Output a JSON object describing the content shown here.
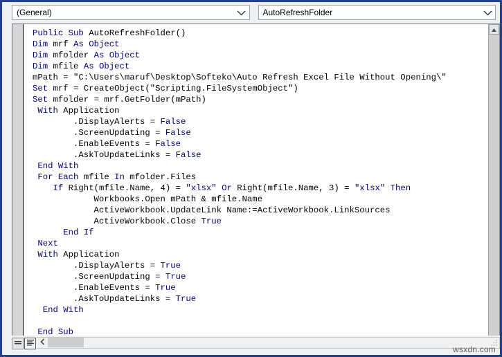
{
  "window": {
    "border_color": "#223f8f",
    "background": "#eef0f2"
  },
  "toolbar": {
    "object_combo": {
      "value": "(General)",
      "placeholder": "(General)",
      "arrow_icon": "chevron-down-icon"
    },
    "procedure_combo": {
      "value": "AutoRefreshFolder",
      "placeholder": "AutoRefreshFolder",
      "arrow_icon": "chevron-down-icon"
    }
  },
  "editor": {
    "keyword_color": "#00007f",
    "text_color": "#000000",
    "background": "#ffffff",
    "lines": [
      [
        {
          "t": "Public Sub ",
          "k": true
        },
        {
          "t": "AutoRefreshFolder()",
          "k": false
        }
      ],
      [
        {
          "t": "Dim ",
          "k": true
        },
        {
          "t": "mrf ",
          "k": false
        },
        {
          "t": "As ",
          "k": true
        },
        {
          "t": "Object",
          "k": true
        }
      ],
      [
        {
          "t": "Dim ",
          "k": true
        },
        {
          "t": "mfolder ",
          "k": false
        },
        {
          "t": "As ",
          "k": true
        },
        {
          "t": "Object",
          "k": true
        }
      ],
      [
        {
          "t": "Dim ",
          "k": true
        },
        {
          "t": "mfile ",
          "k": false
        },
        {
          "t": "As ",
          "k": true
        },
        {
          "t": "Object",
          "k": true
        }
      ],
      [
        {
          "t": "mPath = \"C:\\Users\\maruf\\Desktop\\Softeko\\Auto Refresh Excel File Without Opening\\\"",
          "k": false
        }
      ],
      [
        {
          "t": "Set ",
          "k": true
        },
        {
          "t": "mrf = CreateObject(\"Scripting.FileSystemObject\")",
          "k": false
        }
      ],
      [
        {
          "t": "Set ",
          "k": true
        },
        {
          "t": "mfolder = mrf.GetFolder(mPath)",
          "k": false
        }
      ],
      [
        {
          "t": " ",
          "k": false
        },
        {
          "t": "With ",
          "k": true
        },
        {
          "t": "Application",
          "k": false
        }
      ],
      [
        {
          "t": "        .DisplayAlerts = ",
          "k": false
        },
        {
          "t": "False",
          "k": true
        }
      ],
      [
        {
          "t": "        .ScreenUpdating = ",
          "k": false
        },
        {
          "t": "False",
          "k": true
        }
      ],
      [
        {
          "t": "        .EnableEvents = ",
          "k": false
        },
        {
          "t": "False",
          "k": true
        }
      ],
      [
        {
          "t": "        .AskToUpdateLinks = ",
          "k": false
        },
        {
          "t": "False",
          "k": true
        }
      ],
      [
        {
          "t": " ",
          "k": false
        },
        {
          "t": "End With",
          "k": true
        }
      ],
      [
        {
          "t": " ",
          "k": false
        },
        {
          "t": "For Each ",
          "k": true
        },
        {
          "t": "mfile ",
          "k": false
        },
        {
          "t": "In ",
          "k": true
        },
        {
          "t": "mfolder.Files",
          "k": false
        }
      ],
      [
        {
          "t": "    ",
          "k": false
        },
        {
          "t": "If ",
          "k": true
        },
        {
          "t": "Right(mfile.Name, 4) = ",
          "k": false
        },
        {
          "t": "\"xlsx\" ",
          "k": true
        },
        {
          "t": "Or ",
          "k": true
        },
        {
          "t": "Right(mfile.Name, 3) = ",
          "k": false
        },
        {
          "t": "\"xlsx\" ",
          "k": true
        },
        {
          "t": "Then",
          "k": true
        }
      ],
      [
        {
          "t": "            Workbooks.Open mPath & mfile.Name",
          "k": false
        }
      ],
      [
        {
          "t": "            ActiveWorkbook.UpdateLink Name:=ActiveWorkbook.LinkSources",
          "k": false
        }
      ],
      [
        {
          "t": "            ActiveWorkbook.Close ",
          "k": false
        },
        {
          "t": "True",
          "k": true
        }
      ],
      [
        {
          "t": "      ",
          "k": false
        },
        {
          "t": "End If",
          "k": true
        }
      ],
      [
        {
          "t": " ",
          "k": false
        },
        {
          "t": "Next",
          "k": true
        }
      ],
      [
        {
          "t": " ",
          "k": false
        },
        {
          "t": "With ",
          "k": true
        },
        {
          "t": "Application",
          "k": false
        }
      ],
      [
        {
          "t": "        .DisplayAlerts = ",
          "k": false
        },
        {
          "t": "True",
          "k": true
        }
      ],
      [
        {
          "t": "        .ScreenUpdating = ",
          "k": false
        },
        {
          "t": "True",
          "k": true
        }
      ],
      [
        {
          "t": "        .EnableEvents = ",
          "k": false
        },
        {
          "t": "True",
          "k": true
        }
      ],
      [
        {
          "t": "        .AskToUpdateLinks = ",
          "k": false
        },
        {
          "t": "True",
          "k": true
        }
      ],
      [
        {
          "t": "  ",
          "k": false
        },
        {
          "t": "End With",
          "k": true
        }
      ],
      [
        {
          "t": "",
          "k": false
        }
      ],
      [
        {
          "t": " ",
          "k": false
        },
        {
          "t": "End Sub",
          "k": true
        }
      ]
    ]
  },
  "scrollbars": {
    "vertical": {
      "up_arrow_icon": "caret-up-icon"
    },
    "horizontal": {
      "left_arrow_icon": "caret-left-icon",
      "grip_icon": "resize-grip-icon"
    }
  },
  "view_buttons": {
    "procedure_view": "procedure-view-icon",
    "full_module_view": "full-module-view-icon"
  },
  "watermark": {
    "text": "wsxdn.com"
  }
}
